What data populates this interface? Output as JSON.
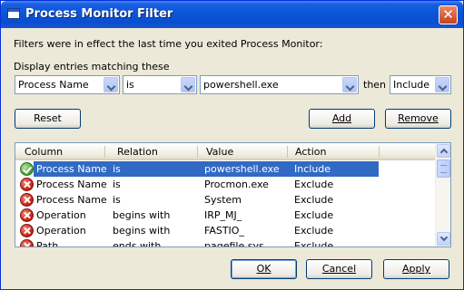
{
  "window": {
    "title": "Process Monitor Filter"
  },
  "intro_text": "Filters were in effect the last time you exited Process Monitor:",
  "match_label": "Display entries matching these",
  "filter": {
    "column": "Process Name",
    "relation": "is",
    "value": "powershell.exe",
    "then_label": "then",
    "action": "Include"
  },
  "buttons": {
    "reset": "Reset",
    "add": "Add",
    "remove": "Remove",
    "ok": "OK",
    "cancel": "Cancel",
    "apply": "Apply"
  },
  "table": {
    "headers": [
      "Column",
      "Relation",
      "Value",
      "Action"
    ],
    "rows": [
      {
        "icon": "check-icon",
        "column": "Process Name",
        "relation": "is",
        "value": "powershell.exe",
        "action": "Include"
      },
      {
        "icon": "error-x-icon",
        "column": "Process Name",
        "relation": "is",
        "value": "Procmon.exe",
        "action": "Exclude"
      },
      {
        "icon": "error-x-icon",
        "column": "Process Name",
        "relation": "is",
        "value": "System",
        "action": "Exclude"
      },
      {
        "icon": "error-x-icon",
        "column": "Operation",
        "relation": "begins with",
        "value": "IRP_MJ_",
        "action": "Exclude"
      },
      {
        "icon": "error-x-icon",
        "column": "Operation",
        "relation": "begins with",
        "value": "FASTIO_",
        "action": "Exclude"
      },
      {
        "icon": "error-x-icon",
        "column": "Path",
        "relation": "ends with",
        "value": "pagefile.sys",
        "action": "Exclude"
      }
    ]
  },
  "colors": {
    "title_bar": "#0a55d8",
    "dialog_bg": "#ece9d8",
    "selection": "#316ac5"
  }
}
